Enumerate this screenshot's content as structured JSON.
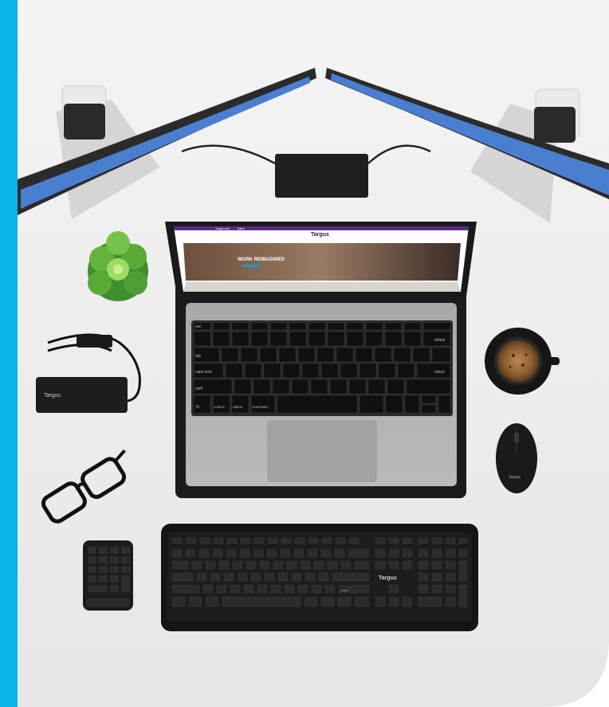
{
  "colors": {
    "accent_stripe": "#0ab4e6",
    "desk": "#efefef",
    "screen_blue": "#4a7fd0",
    "site_purple": "#5b2a86",
    "device_black": "#1c1c1e"
  },
  "laptop_screen": {
    "nav_left": "Targus.com",
    "nav_left_2": "Sales",
    "brand": "Targus",
    "hero_headline": "WORK REIMAGINED"
  },
  "keyboard_labels": {
    "esc": "esc",
    "tab": "tab",
    "caps": "caps lock",
    "shift": "shift",
    "fn": "fn",
    "control": "control",
    "option": "option",
    "command": "command",
    "delete": "delete",
    "return": "return",
    "enter": "enter"
  },
  "branding": {
    "charger": "Targus",
    "mouse": "Targus",
    "keyboard": "Targus"
  },
  "icons": [
    "plant-icon",
    "coffee-icon",
    "glasses-icon"
  ]
}
